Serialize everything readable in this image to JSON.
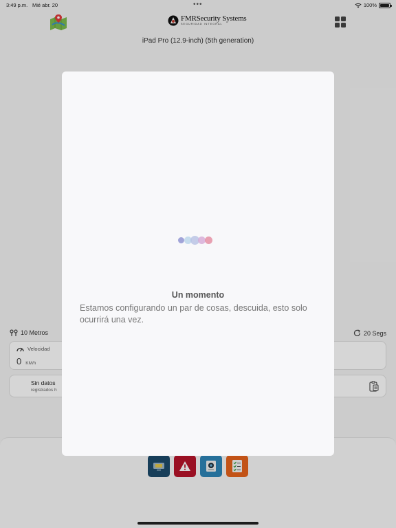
{
  "status_bar": {
    "time": "3:49 p.m.",
    "date": "Mié abr. 20",
    "battery": "100%"
  },
  "header": {
    "brand_name": "FMRSecurity Systems",
    "brand_tagline": "SEGURIDAD INTEGRAL",
    "device_name": "iPad Pro (12.9-inch) (5th generation)"
  },
  "settings": {
    "distance": "10 Metros",
    "interval": "20 Segs"
  },
  "speed_card": {
    "label": "Velocidad",
    "value": "0",
    "unit": "KM/h"
  },
  "data_card": {
    "title": "Sin datos",
    "subtitle": "registrados h"
  },
  "modal": {
    "title": "Un momento",
    "message": "Estamos configurando un par de cosas, descuida, esto solo ocurrirá una vez.",
    "loader_colors": [
      "#8b8fd0",
      "#b9d4ea",
      "#b7c1e4",
      "#d6a9d6",
      "#e4899f"
    ]
  },
  "actions": {
    "colors": [
      "#1c4a6b",
      "#b8142a",
      "#2e86b8",
      "#e8641c"
    ],
    "icons": [
      "screen-icon",
      "warning-icon",
      "camera-icon",
      "checklist-icon"
    ]
  }
}
